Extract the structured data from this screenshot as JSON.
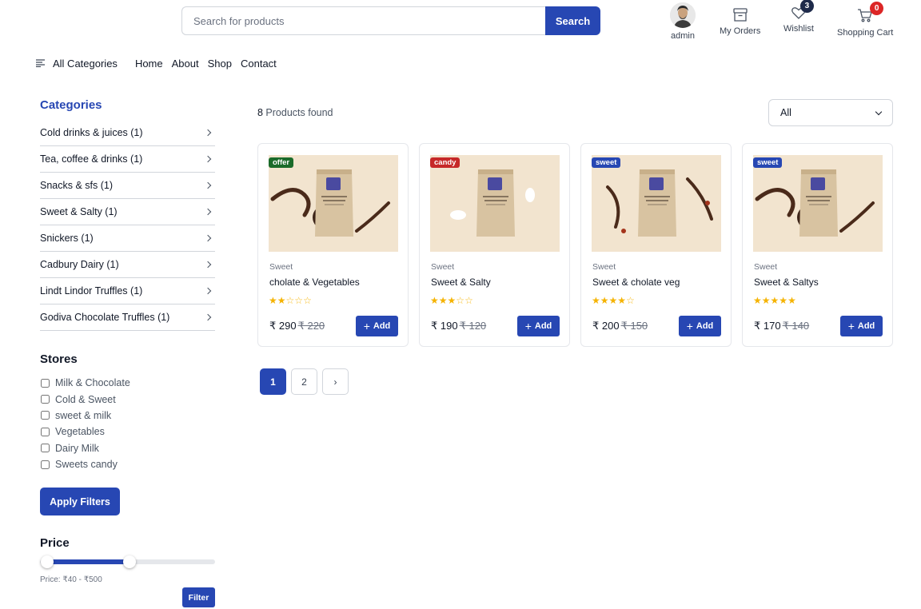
{
  "header": {
    "search_placeholder": "Search for products",
    "search_button": "Search",
    "user": "admin",
    "orders": "My Orders",
    "wishlist": "Wishlist",
    "wishlist_count": "3",
    "cart": "Shopping Cart",
    "cart_count": "0"
  },
  "nav": {
    "all_categories": "All Categories",
    "links": [
      "Home",
      "About",
      "Shop",
      "Contact"
    ]
  },
  "sidebar": {
    "categories_title": "Categories",
    "categories": [
      "Cold drinks & juices (1)",
      "Tea, coffee & drinks (1)",
      "Snacks & sfs (1)",
      "Sweet & Salty (1)",
      "Snickers (1)",
      "Cadbury Dairy (1)",
      "Lindt Lindor Truffles (1)",
      "Godiva Chocolate Truffles (1)"
    ],
    "stores_title": "Stores",
    "stores": [
      "Milk & Chocolate",
      "Cold & Sweet",
      "sweet & milk",
      "Vegetables",
      "Dairy Milk",
      "Sweets candy"
    ],
    "apply_button": "Apply Filters",
    "price_title": "Price",
    "price_range": "Price: ₹40 - ₹500",
    "price_slider": {
      "min_fraction": 0.04,
      "max_fraction": 0.51
    },
    "filter_button": "Filter"
  },
  "main": {
    "found_count": "8",
    "found_label": " Products found",
    "sort_value": "All",
    "products": [
      {
        "tag": "offer",
        "tag_color": "#1b6b2a",
        "category": "Sweet",
        "name": "cholate & Vegetables",
        "rating": 2,
        "price": "₹ 290",
        "old_price": "₹ 220",
        "add_label": "Add"
      },
      {
        "tag": "candy",
        "tag_color": "#c62828",
        "category": "Sweet",
        "name": "Sweet & Salty",
        "rating": 3,
        "price": "₹ 190",
        "old_price": "₹ 120",
        "add_label": "Add"
      },
      {
        "tag": "sweet",
        "tag_color": "#2747b3",
        "category": "Sweet",
        "name": "Sweet & cholate veg",
        "rating": 4,
        "price": "₹ 200",
        "old_price": "₹ 150",
        "add_label": "Add"
      },
      {
        "tag": "sweet",
        "tag_color": "#2747b3",
        "category": "Sweet",
        "name": "Sweet & Saltys",
        "rating": 5,
        "price": "₹ 170",
        "old_price": "₹ 140",
        "add_label": "Add"
      }
    ],
    "pages": [
      "1",
      "2"
    ],
    "next_label": "›"
  },
  "colors": {
    "accent": "#2747b3",
    "star": "#f5b301"
  }
}
